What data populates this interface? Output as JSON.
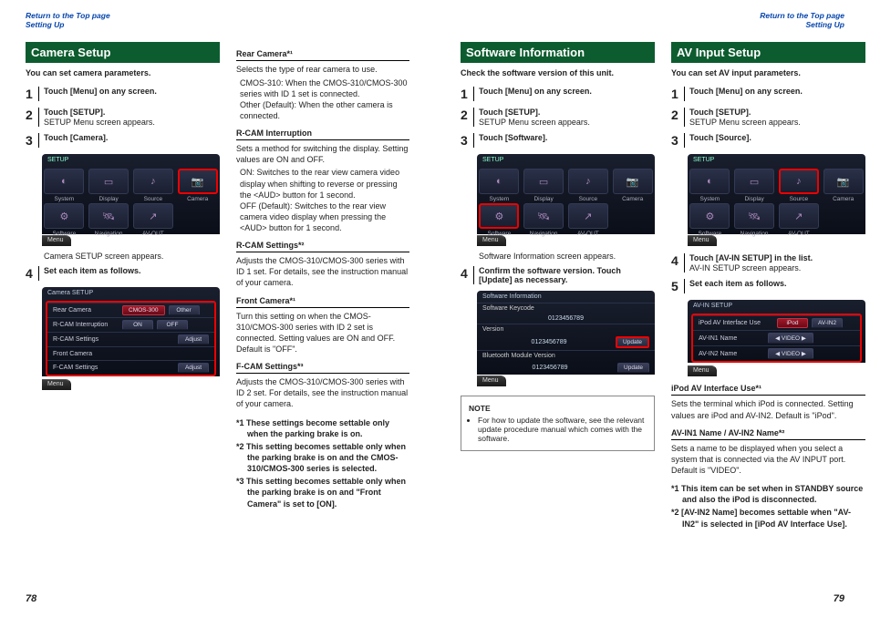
{
  "nav": {
    "return": "Return to the Top page",
    "section": "Setting Up"
  },
  "pages": {
    "left": "78",
    "right": "79"
  },
  "camera": {
    "title": "Camera Setup",
    "intro": "You can set camera parameters.",
    "s1": "Touch [Menu] on any screen.",
    "s2": "Touch [SETUP].",
    "s2sub": "SETUP Menu screen appears.",
    "s3": "Touch [Camera].",
    "after": "Camera SETUP screen appears.",
    "s4": "Set each item as follows.",
    "screenTitle": "Camera SETUP",
    "rows": {
      "r1": "Rear Camera",
      "r1a": "CMOS-300",
      "r1b": "Other",
      "r2": "R-CAM Interruption",
      "r2a": "ON",
      "r2b": "OFF",
      "r3": "R-CAM Settings",
      "r3a": "Adjust",
      "r4": "Front Camera",
      "r5": "F-CAM Settings",
      "r5a": "Adjust"
    }
  },
  "camterms": {
    "t1h": "Rear Camera*¹",
    "t1b": "Selects the type of rear camera to use.",
    "t1d1": "CMOS-310: When the CMOS-310/CMOS-300 series with ID 1 set is connected.",
    "t1d2": "Other (Default): When the other camera is connected.",
    "t2h": "R-CAM Interruption",
    "t2b": "Sets a method for switching the display. Setting values are ON and OFF.",
    "t2d1": "ON: Switches to the rear view camera video display when shifting to reverse or pressing the <AUD> button for 1 second.",
    "t2d2": "OFF (Default): Switches to the rear view camera video display when pressing the <AUD> button for 1 second.",
    "t3h": "R-CAM Settings*²",
    "t3b": "Adjusts the CMOS-310/CMOS-300 series with ID 1 set. For details, see the instruction manual of your camera.",
    "t4h": "Front Camera*¹",
    "t4b": "Turn this setting on when the CMOS-310/CMOS-300 series with ID 2 set is connected. Setting values are ON and OFF. Default is \"OFF\".",
    "t5h": "F-CAM Settings*³",
    "t5b": "Adjusts the CMOS-310/CMOS-300 series with ID 2 set. For details, see the instruction manual of your camera.",
    "f1": "*1 These settings become settable only when the parking brake is on.",
    "f2": "*2 This setting becomes settable only when the parking brake is on and the CMOS-310/CMOS-300 series is selected.",
    "f3": "*3 This setting becomes settable only when the parking brake is on and \"Front Camera\" is set to [ON]."
  },
  "sw": {
    "title": "Software Information",
    "intro": "Check the software version of this unit.",
    "s1": "Touch [Menu] on any screen.",
    "s2": "Touch [SETUP].",
    "s2sub": "SETUP Menu screen appears.",
    "s3": "Touch [Software].",
    "after": "Software Information screen appears.",
    "s4": "Confirm the software version. Touch [Update] as necessary.",
    "screenTitle": "Software Information",
    "rows": {
      "k1": "Software Keycode",
      "v1": "0123456789",
      "k2": "Version",
      "v2": "0123456789",
      "u": "Update",
      "k3": "Bluetooth Module Version",
      "v3": "0123456789"
    },
    "noteTitle": "NOTE",
    "note": "For how to update the software, see the relevant update procedure manual which comes with the software."
  },
  "av": {
    "title": "AV Input Setup",
    "intro": "You can set AV input parameters.",
    "s1": "Touch [Menu] on any screen.",
    "s2": "Touch [SETUP].",
    "s2sub": "SETUP Menu screen appears.",
    "s3": "Touch [Source].",
    "s4": "Touch [AV-IN SETUP] in the list.",
    "s4sub": "AV-IN SETUP screen appears.",
    "s5": "Set each item as follows.",
    "screenTitle": "AV-IN SETUP",
    "rows": {
      "r1": "iPod AV Interface Use",
      "r1a": "iPod",
      "r1b": "AV-IN2",
      "r2": "AV-IN1 Name",
      "r2v": "VIDEO",
      "r3": "AV-IN2 Name",
      "r3v": "VIDEO"
    },
    "t1h": "iPod AV Interface Use*¹",
    "t1b": "Sets the terminal which iPod is connected. Setting values are iPod and AV-IN2. Default is \"iPod\".",
    "t2h": "AV-IN1 Name / AV-IN2 Name*²",
    "t2b": "Sets a name to be displayed when you select a system that is connected via the AV INPUT port. Default is \"VIDEO\".",
    "f1": "*1 This item can be set when in STANDBY source and also the iPod is disconnected.",
    "f2": "*2 [AV-IN2 Name] becomes settable when \"AV-IN2\" is selected in [iPod AV Interface Use]."
  },
  "setup": {
    "hdr": "SETUP",
    "icons": {
      "system": "System",
      "display": "Display",
      "source": "Source",
      "camera": "Camera",
      "software": "Software",
      "navigation": "Navigation",
      "avout": "AV-OUT"
    },
    "menu": "Menu"
  }
}
